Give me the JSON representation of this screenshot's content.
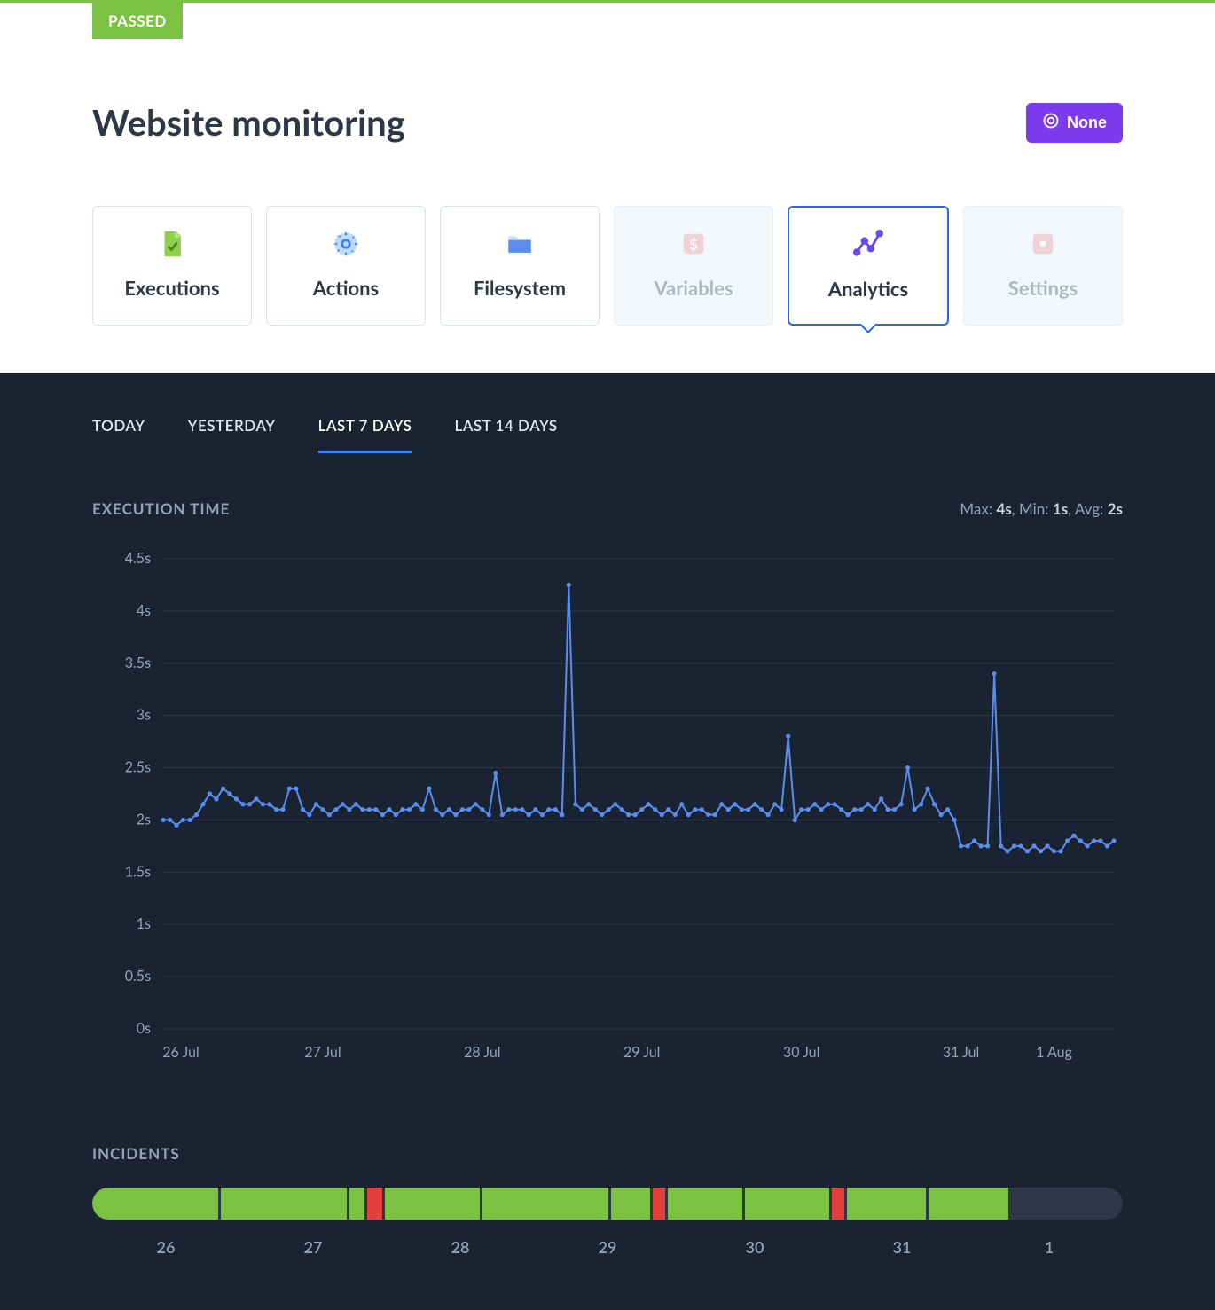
{
  "status_badge": "PASSED",
  "page_title": "Website monitoring",
  "none_button_label": "None",
  "tabs": [
    {
      "key": "executions",
      "label": "Executions",
      "icon": "doc-check",
      "state": "normal"
    },
    {
      "key": "actions",
      "label": "Actions",
      "icon": "gear",
      "state": "normal"
    },
    {
      "key": "filesystem",
      "label": "Filesystem",
      "icon": "folder",
      "state": "normal"
    },
    {
      "key": "variables",
      "label": "Variables",
      "icon": "var",
      "state": "dim"
    },
    {
      "key": "analytics",
      "label": "Analytics",
      "icon": "chart",
      "state": "active"
    },
    {
      "key": "settings",
      "label": "Settings",
      "icon": "settings",
      "state": "dim"
    }
  ],
  "range_tabs": [
    {
      "label": "TODAY",
      "active": false
    },
    {
      "label": "YESTERDAY",
      "active": false
    },
    {
      "label": "LAST 7 DAYS",
      "active": true
    },
    {
      "label": "LAST 14 DAYS",
      "active": false
    }
  ],
  "execution_time": {
    "title": "EXECUTION TIME",
    "stats": {
      "max_label": "Max: ",
      "max_value": "4s",
      "min_label": ", Min: ",
      "min_value": "1s",
      "avg_label": ", Avg: ",
      "avg_value": "2s"
    }
  },
  "incidents": {
    "title": "INCIDENTS",
    "day_labels": [
      "26",
      "27",
      "28",
      "29",
      "30",
      "31",
      "1"
    ]
  },
  "chart_data": {
    "type": "line",
    "title": "EXECUTION TIME",
    "xlabel": "",
    "ylabel": "",
    "ylim": [
      0,
      4.5
    ],
    "y_ticks": [
      "0s",
      "0.5s",
      "1s",
      "1.5s",
      "2s",
      "2.5s",
      "3s",
      "3.5s",
      "4s",
      "4.5s"
    ],
    "x_categories": [
      "26 Jul",
      "27 Jul",
      "28 Jul",
      "29 Jul",
      "30 Jul",
      "31 Jul",
      "1 Aug"
    ],
    "series": [
      {
        "name": "execution_time_seconds",
        "values": [
          2.0,
          2.0,
          1.95,
          2.0,
          2.0,
          2.05,
          2.15,
          2.25,
          2.2,
          2.3,
          2.25,
          2.2,
          2.15,
          2.15,
          2.2,
          2.15,
          2.15,
          2.1,
          2.1,
          2.3,
          2.3,
          2.1,
          2.05,
          2.15,
          2.1,
          2.05,
          2.1,
          2.15,
          2.1,
          2.15,
          2.1,
          2.1,
          2.1,
          2.05,
          2.1,
          2.05,
          2.1,
          2.1,
          2.15,
          2.1,
          2.3,
          2.1,
          2.05,
          2.1,
          2.05,
          2.1,
          2.1,
          2.15,
          2.1,
          2.05,
          2.45,
          2.05,
          2.1,
          2.1,
          2.1,
          2.05,
          2.1,
          2.05,
          2.1,
          2.1,
          2.05,
          4.25,
          2.15,
          2.1,
          2.15,
          2.1,
          2.05,
          2.1,
          2.15,
          2.1,
          2.05,
          2.05,
          2.1,
          2.15,
          2.1,
          2.05,
          2.1,
          2.05,
          2.15,
          2.05,
          2.1,
          2.1,
          2.05,
          2.05,
          2.15,
          2.1,
          2.15,
          2.1,
          2.1,
          2.15,
          2.1,
          2.05,
          2.15,
          2.1,
          2.8,
          2.0,
          2.1,
          2.1,
          2.15,
          2.1,
          2.15,
          2.15,
          2.1,
          2.05,
          2.1,
          2.1,
          2.15,
          2.1,
          2.2,
          2.1,
          2.1,
          2.15,
          2.5,
          2.1,
          2.15,
          2.3,
          2.15,
          2.05,
          2.1,
          2.0,
          1.75,
          1.75,
          1.8,
          1.75,
          1.75,
          3.4,
          1.75,
          1.7,
          1.75,
          1.75,
          1.7,
          1.75,
          1.7,
          1.75,
          1.7,
          1.7,
          1.8,
          1.85,
          1.8,
          1.75,
          1.8,
          1.8,
          1.75,
          1.8
        ]
      }
    ],
    "incidents_timeline": {
      "days": [
        "26",
        "27",
        "28",
        "29",
        "30",
        "31",
        "1"
      ],
      "segments": [
        {
          "status": "ok",
          "width_pct": 12.2
        },
        {
          "status": "ok",
          "width_pct": 12.2
        },
        {
          "status": "ok",
          "width_pct": 1.5
        },
        {
          "status": "fail",
          "width_pct": 1.5
        },
        {
          "status": "ok",
          "width_pct": 9.2
        },
        {
          "status": "ok",
          "width_pct": 12.2
        },
        {
          "status": "ok",
          "width_pct": 3.8
        },
        {
          "status": "fail",
          "width_pct": 1.2
        },
        {
          "status": "ok",
          "width_pct": 7.2
        },
        {
          "status": "ok",
          "width_pct": 8.2
        },
        {
          "status": "fail",
          "width_pct": 1.2
        },
        {
          "status": "ok",
          "width_pct": 7.7
        },
        {
          "status": "ok",
          "width_pct": 7.7
        },
        {
          "status": "empty",
          "width_pct": 5.0
        }
      ]
    }
  },
  "colors": {
    "green": "#7bc142",
    "purple": "#7c3aed",
    "blue": "#2962ff",
    "line": "#5b8def",
    "red": "#e53e3e",
    "dark_bg": "#1a2332"
  }
}
